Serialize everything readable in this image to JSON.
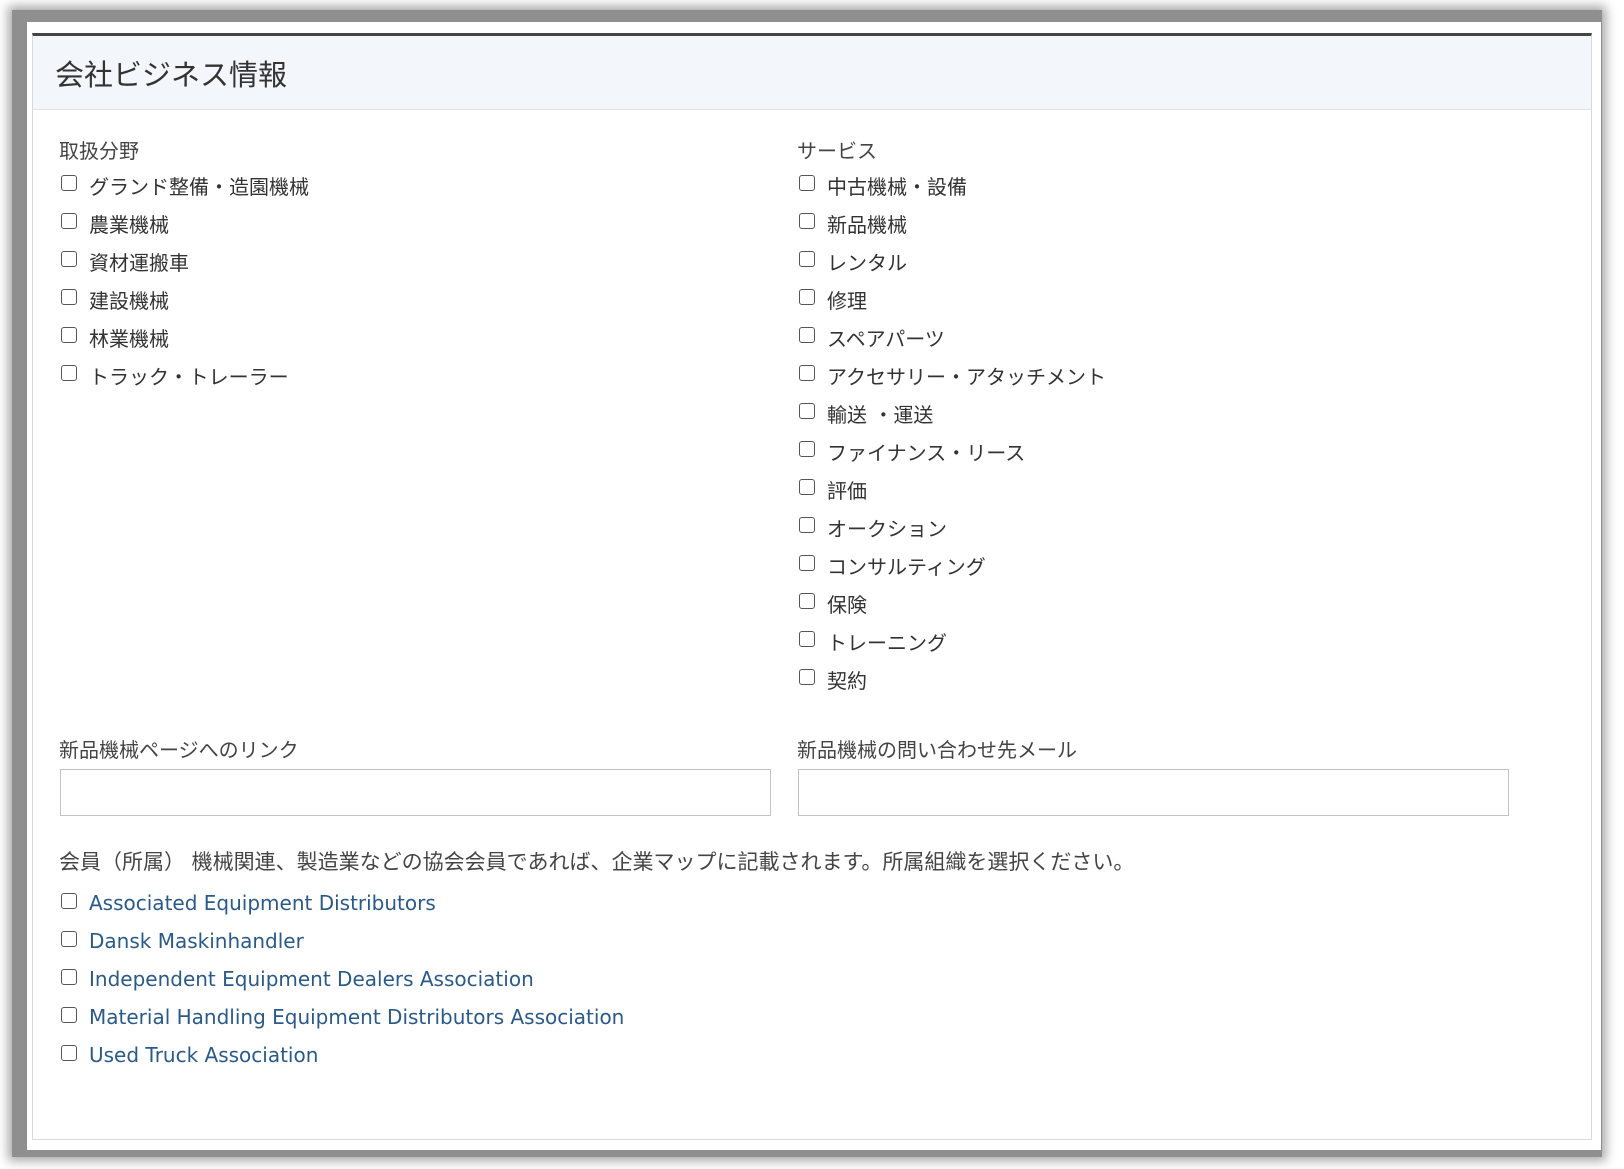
{
  "panel": {
    "title": "会社ビジネス情報"
  },
  "business_fields": {
    "label": "取扱分野",
    "items": [
      "グランド整備・造園機械",
      "農業機械",
      "資材運搬車",
      "建設機械",
      "林業機械",
      "トラック・トレーラー"
    ]
  },
  "services": {
    "label": "サービス",
    "items": [
      "中古機械・設備",
      "新品機械",
      "レンタル",
      "修理",
      "スペアパーツ",
      "アクセサリー・アタッチメント",
      "輸送 ・運送",
      "ファイナンス・リース",
      "評価",
      "オークション",
      "コンサルティング",
      "保険",
      "トレーニング",
      "契約"
    ]
  },
  "new_machine_link": {
    "label": "新品機械ページへのリンク",
    "value": ""
  },
  "new_machine_email": {
    "label": "新品機械の問い合わせ先メール",
    "value": ""
  },
  "membership": {
    "note": "会員（所属） 機械関連、製造業などの協会会員であれば、企業マップに記載されます。所属組織を選択ください。",
    "items": [
      "Associated Equipment Distributors",
      "Dansk Maskinhandler",
      "Independent Equipment Dealers Association",
      "Material Handling Equipment Distributors Association",
      "Used Truck Association"
    ]
  },
  "colors": {
    "link": "#2a5a8a",
    "header_bg": "#f3f6fa",
    "panel_top_border": "#444444"
  }
}
